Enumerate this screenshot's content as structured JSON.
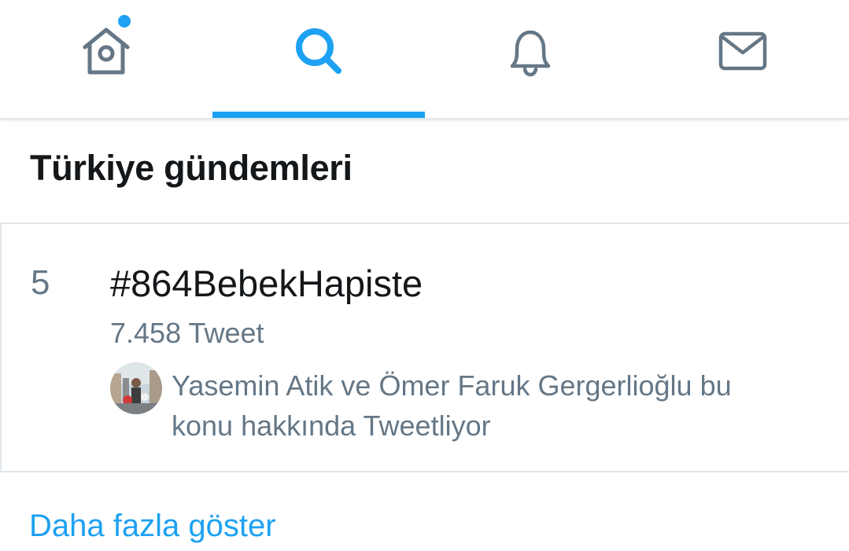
{
  "tabs": [
    {
      "icon": "home-icon",
      "active": false,
      "has_notification_dot": true
    },
    {
      "icon": "search-icon",
      "active": true
    },
    {
      "icon": "bell-icon",
      "active": false
    },
    {
      "icon": "mail-icon",
      "active": false
    }
  ],
  "colors": {
    "accent": "#1da1f2",
    "icon_inactive": "#657786",
    "text_primary": "#14171a",
    "text_secondary": "#657786",
    "divider": "#e1e8ed"
  },
  "section": {
    "title": "Türkiye gündemleri"
  },
  "trend": {
    "rank": "5",
    "hashtag": "#864BebekHapiste",
    "tweet_count": "7.458 Tweet",
    "context_line1": "Yasemin Atik ve Ömer Faruk Gergerlioğlu bu",
    "context_line2": "konu hakkında Tweetliyor"
  },
  "show_more": "Daha fazla göster"
}
